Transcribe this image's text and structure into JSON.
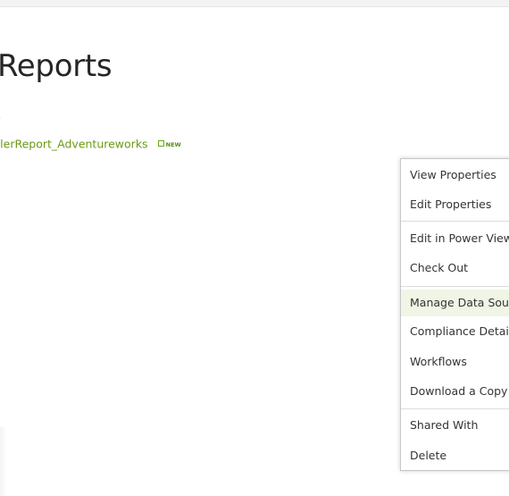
{
  "page": {
    "title": "Reports",
    "column_header": "e"
  },
  "document": {
    "name": "ellerReport_Adventureworks",
    "badge": "NEW"
  },
  "context_menu": {
    "items": [
      {
        "label": "View Properties"
      },
      {
        "label": "Edit Properties"
      },
      {
        "label": "Edit in Power View"
      },
      {
        "label": "Check Out"
      },
      {
        "label": "Manage Data Sourc",
        "highlighted": true
      },
      {
        "label": "Compliance Details"
      },
      {
        "label": "Workflows"
      },
      {
        "label": "Download a Copy"
      },
      {
        "label": "Shared With"
      },
      {
        "label": "Delete"
      }
    ]
  },
  "colors": {
    "link": "#6a9a14",
    "highlight": "#f0f5e6",
    "menu_border": "#c6c6c6"
  }
}
